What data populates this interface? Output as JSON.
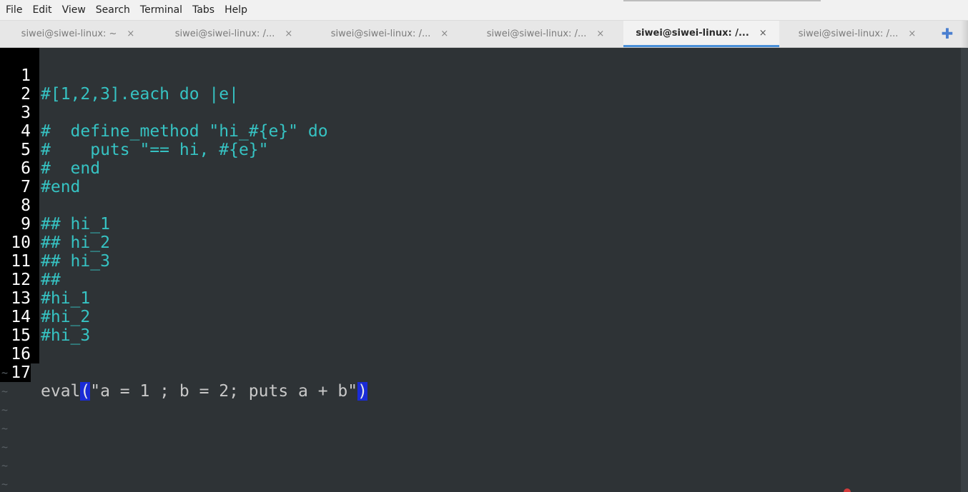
{
  "menu": {
    "items": [
      {
        "label": "File"
      },
      {
        "label": "Edit"
      },
      {
        "label": "View"
      },
      {
        "label": "Search"
      },
      {
        "label": "Terminal"
      },
      {
        "label": "Tabs"
      },
      {
        "label": "Help"
      }
    ]
  },
  "tabs": [
    {
      "label": "siwei@siwei-linux: ~",
      "close": "×",
      "active": false
    },
    {
      "label": "siwei@siwei-linux: /...",
      "close": "×",
      "active": false
    },
    {
      "label": "siwei@siwei-linux: /...",
      "close": "×",
      "active": false
    },
    {
      "label": "siwei@siwei-linux: /...",
      "close": "×",
      "active": false
    },
    {
      "label": "siwei@siwei-linux: /...",
      "close": "×",
      "active": true
    },
    {
      "label": "siwei@siwei-linux: /...",
      "close": "×",
      "active": false
    }
  ],
  "new_tab": {
    "icon": "plus-icon",
    "glyph": "✚"
  },
  "editor": {
    "lines": [
      {
        "num": "1",
        "text": "#[1,2,3].each do |e|"
      },
      {
        "num": "2",
        "text": ""
      },
      {
        "num": "3",
        "text": "#  define_method \"hi_#{e}\" do"
      },
      {
        "num": "4",
        "text": "#    puts \"== hi, #{e}\""
      },
      {
        "num": "5",
        "text": "#  end"
      },
      {
        "num": "6",
        "text": "#end"
      },
      {
        "num": "7",
        "text": ""
      },
      {
        "num": "8",
        "text": "## hi_1"
      },
      {
        "num": "9",
        "text": "## hi_2"
      },
      {
        "num": "10",
        "text": "## hi_3"
      },
      {
        "num": "11",
        "text": "##"
      },
      {
        "num": "12",
        "text": "#hi_1"
      },
      {
        "num": "13",
        "text": "#hi_2"
      },
      {
        "num": "14",
        "text": "#hi_3"
      },
      {
        "num": "15",
        "text": ""
      },
      {
        "num": "16",
        "text": ""
      },
      {
        "num": "17",
        "pre": "eval",
        "open_paren": "(",
        "mid": "\"a = 1 ; b = 2; puts a + b\"",
        "close_paren": ")"
      }
    ],
    "empty_marker": "~",
    "empty_marker_count": 7
  },
  "colors": {
    "comment": "#36c3c3",
    "plain_text": "#c8c8c8",
    "paren_highlight": "#1a2bd6",
    "active_tab_underline": "#4a90d9",
    "background": "#2e3336"
  }
}
